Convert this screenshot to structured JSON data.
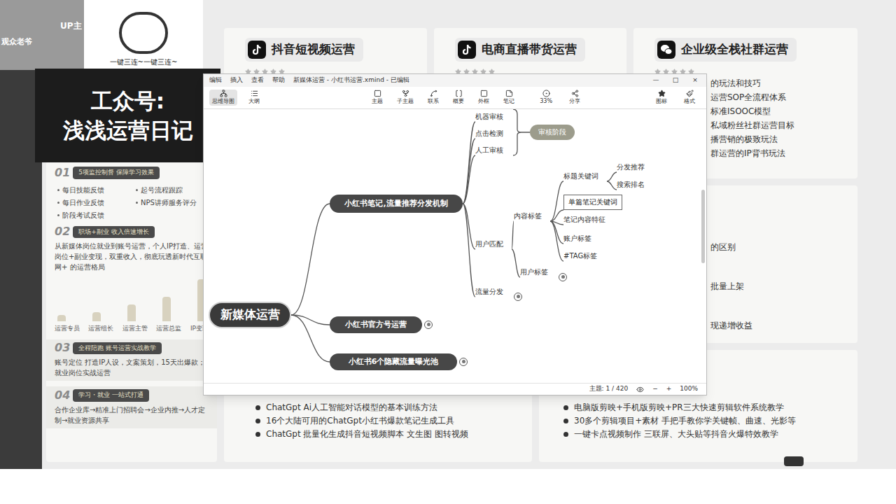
{
  "overlay": {
    "up_label": "UP主",
    "viewer_label": "观众老爷",
    "slogan": "一键三连~一键三连~",
    "brand_lines": [
      "工众号:",
      "浅浅运营日记"
    ]
  },
  "left_panel": {
    "sections": [
      {
        "number": "01",
        "heading": "5项监控制督 保障学习效果",
        "kind": "items",
        "items": [
          "每日技能反馈",
          "起号流程跟踪",
          "每日作业反馈",
          "NPS讲师服务评分",
          "阶段考试反馈"
        ]
      },
      {
        "number": "02",
        "heading": "职场+副业 收入倍速增长",
        "kind": "chart",
        "text": "从新媒体岗位就业到账号运营，个人IP打造、运营岗位+副业变现，双重收入，彻底玩透新时代互联网+ 的运营格局",
        "chart": {
          "labels": [
            "运营专员",
            "运营组长",
            "运营主管",
            "运营总监",
            "IP变现"
          ],
          "values": [
            8,
            12,
            22,
            32,
            55
          ]
        }
      },
      {
        "number": "03",
        "heading": "全程陪跑 账号运营实战教学",
        "kind": "text",
        "text": "账号定位 打造IP人设，文案策划，15天出爆款；就业岗位实战运营"
      },
      {
        "number": "04",
        "heading": "学习・就业 一站式打通",
        "kind": "text",
        "text": "合作企业库→精准上门招聘会→企业内推→人才定制→就业资源共享"
      }
    ]
  },
  "top_cards": [
    {
      "title": "抖音短视频运营",
      "kind": "douyin",
      "stars": 5,
      "lines": []
    },
    {
      "title": "电商直播带货运营",
      "kind": "douyin",
      "stars": 5,
      "lines": []
    },
    {
      "title": "企业级全栈社群运营",
      "kind": "wechat",
      "stars": 5,
      "lines": [
        "的玩法和技巧",
        "运营SOP全流程体系",
        "标准ISOOC模型",
        "私域粉丝社群运营目标",
        "播营销的极致玩法",
        "群运营的IP背书玩法"
      ]
    }
  ],
  "middle_card": {
    "lines": [
      "的区别",
      "批量上架",
      "现递增收益"
    ]
  },
  "bottom_cards": [
    {
      "lines": [
        "ChatGpt Ai人工智能对话模型的基本训练方法",
        "16个大陆可用的ChatGpt小红书爆款笔记生成工具",
        "ChatGpt 批量化生成抖音短视频脚本 文生图 图转视频"
      ]
    },
    {
      "lines": [
        "电脑版剪映+手机版剪映+PR三大快速剪辑软件系统教学",
        "30多个剪辑项目+素材 手把手教你学关键帧、曲速、光影等",
        "一键卡点视频制作 三联屏、大头贴等抖音火爆特效教学"
      ]
    }
  ],
  "xmind": {
    "title": "新媒体运营 - 小红书运营.xmind - 已编辑",
    "menu": [
      "编辑",
      "插入",
      "查看",
      "帮助"
    ],
    "window_controls": [
      "—",
      "□",
      "×"
    ],
    "view_tabs": [
      {
        "label": "思维导图",
        "selected": true
      },
      {
        "label": "大纲",
        "selected": false
      }
    ],
    "tools": [
      "主题",
      "子主题",
      "联系",
      "概要",
      "外框",
      "笔记"
    ],
    "zoom_tool": "33%",
    "share": "分享",
    "right_tools": [
      "图标",
      "格式"
    ],
    "nodes": [
      {
        "label": "新媒体运营",
        "kind": "root",
        "parent": -1,
        "collapsed": false,
        "selected": false
      },
      {
        "label": "小红书笔记,流量推荐分发机制",
        "kind": "branch",
        "parent": 0,
        "collapsed": false,
        "selected": false
      },
      {
        "label": "小红书官方号运营",
        "kind": "branch",
        "parent": 0,
        "collapsed": true,
        "selected": false
      },
      {
        "label": "小红书6个隐藏流量曝光池",
        "kind": "branch",
        "parent": 0,
        "collapsed": true,
        "selected": false
      },
      {
        "label": "机器审核",
        "kind": "topic",
        "parent": 1,
        "collapsed": false,
        "selected": false
      },
      {
        "label": "点击检测",
        "kind": "topic",
        "parent": 1,
        "collapsed": false,
        "selected": false
      },
      {
        "label": "人工审核",
        "kind": "topic",
        "parent": 1,
        "collapsed": false,
        "selected": false
      },
      {
        "label": "审核阶段",
        "kind": "summary",
        "parent": -1,
        "summarizes": [
          4,
          5,
          6
        ],
        "collapsed": false,
        "selected": false
      },
      {
        "label": "用户匹配",
        "kind": "topic",
        "parent": 1,
        "collapsed": false,
        "selected": false
      },
      {
        "label": "内容标签",
        "kind": "topic",
        "parent": 8,
        "collapsed": false,
        "selected": false
      },
      {
        "label": "用户标签",
        "kind": "topic",
        "parent": 8,
        "collapsed": true,
        "selected": false
      },
      {
        "label": "流量分发",
        "kind": "topic",
        "parent": 1,
        "collapsed": true,
        "selected": false
      },
      {
        "label": "标题关键词",
        "kind": "topic",
        "parent": 9,
        "collapsed": false,
        "selected": false
      },
      {
        "label": "分发推荐",
        "kind": "topic",
        "parent": 12,
        "collapsed": false,
        "selected": false
      },
      {
        "label": "搜索排名",
        "kind": "topic",
        "parent": 12,
        "collapsed": false,
        "selected": false
      },
      {
        "label": "单篇笔记关键词",
        "kind": "topic",
        "parent": 9,
        "collapsed": false,
        "selected": true
      },
      {
        "label": "笔记内容特征",
        "kind": "topic",
        "parent": 9,
        "collapsed": false,
        "selected": false
      },
      {
        "label": "账户标签",
        "kind": "topic",
        "parent": 9,
        "collapsed": false,
        "selected": false
      },
      {
        "label": "#TAG标签",
        "kind": "topic",
        "parent": 9,
        "collapsed": false,
        "selected": false
      }
    ],
    "status": {
      "topics": "主题: 1 / 420",
      "minus": "−",
      "plus": "+",
      "zoom": "100%"
    }
  }
}
